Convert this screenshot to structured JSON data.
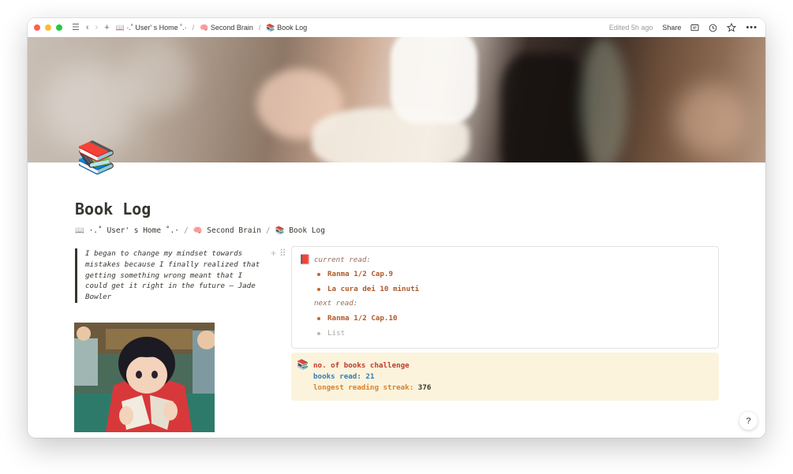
{
  "topbar": {
    "lights": [
      "#ff5f57",
      "#febc2e",
      "#28c840"
    ],
    "breadcrumb": [
      {
        "icon": "📖",
        "label": "·.˚ User' s Home ˚.·"
      },
      {
        "icon": "🧠",
        "label": "Second Brain"
      },
      {
        "icon": "📚",
        "label": "Book Log"
      }
    ],
    "edited": "Edited 5h ago",
    "share": "Share"
  },
  "page": {
    "icon": "📚",
    "title": "Book Log",
    "breadcrumb": [
      {
        "icon": "📖",
        "label": "·.˚ User' s Home ˚.·"
      },
      {
        "icon": "🧠",
        "label": "Second Brain"
      },
      {
        "icon": "📚",
        "label": "Book Log"
      }
    ]
  },
  "quote": {
    "text": "I began to change my mindset towards mistakes because I finally realized that getting something wrong meant that I could get it right in the future — Jade Bowler"
  },
  "reading_callout": {
    "icon": "📕",
    "current_label": "current read:",
    "current_items": [
      "Ranma 1/2 Cap.9",
      "La cura dei 10 minuti"
    ],
    "next_label": "next read:",
    "next_items": [
      "Ranma 1/2 Cap.10"
    ],
    "placeholder": "List"
  },
  "challenge_callout": {
    "icon": "📚",
    "title": "no. of books challenge",
    "books_read_label": "books read:",
    "books_read_value": "21",
    "streak_label": "longest reading streak:",
    "streak_value": "376"
  },
  "colors": {
    "title_red": "#c0392b",
    "books_blue": "#2e7fb8",
    "streak_orange": "#d9822b",
    "callout_yellow": "#fbf3db"
  },
  "help": "?"
}
